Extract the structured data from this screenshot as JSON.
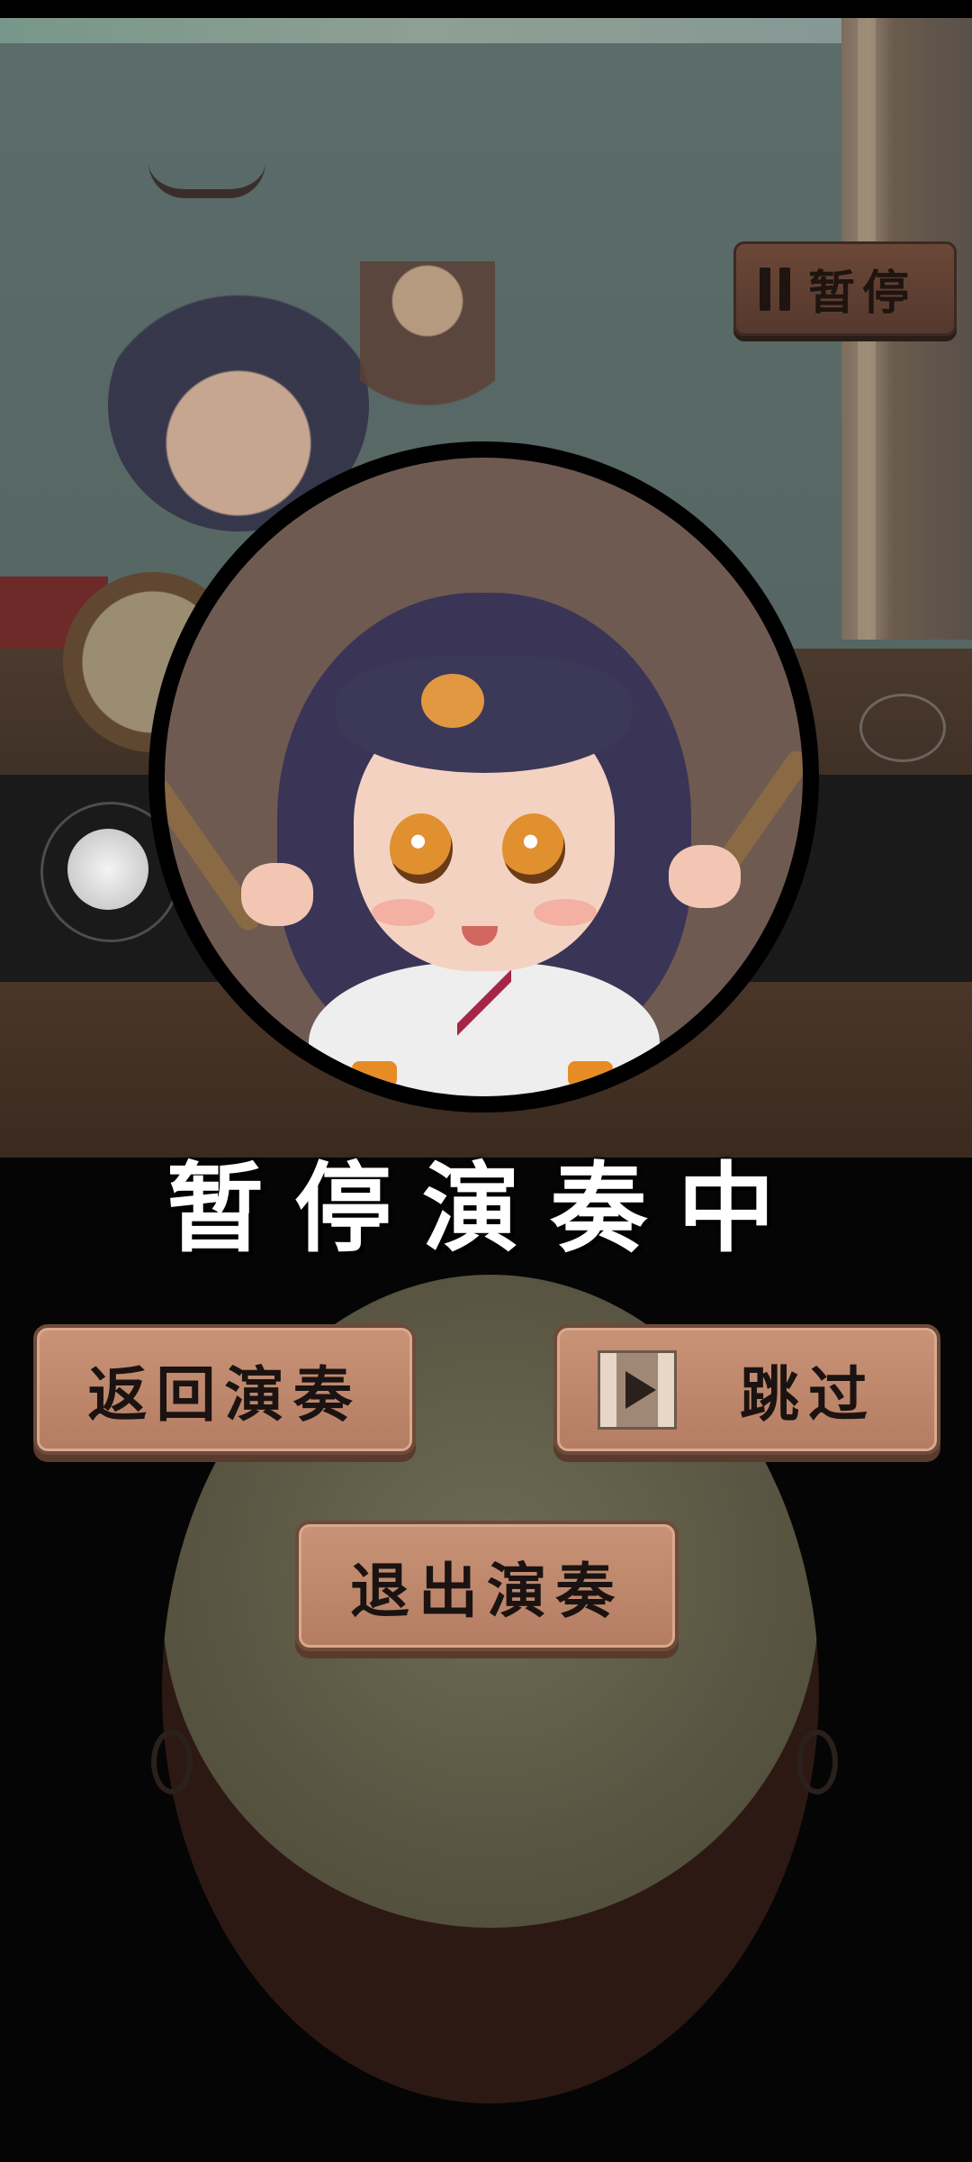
{
  "hud": {
    "pause_label": "暂停"
  },
  "pause_menu": {
    "title": "暂停演奏中",
    "return_label": "返回演奏",
    "skip_label": "跳过",
    "exit_label": "退出演奏"
  },
  "icons": {
    "pause": "pause-icon",
    "skip": "film-play-icon",
    "joystick": "joystick-icon",
    "crest": "crest-icon"
  },
  "colors": {
    "button_wood": "#c99377",
    "title_text": "#ffffff",
    "background": "#050505"
  }
}
